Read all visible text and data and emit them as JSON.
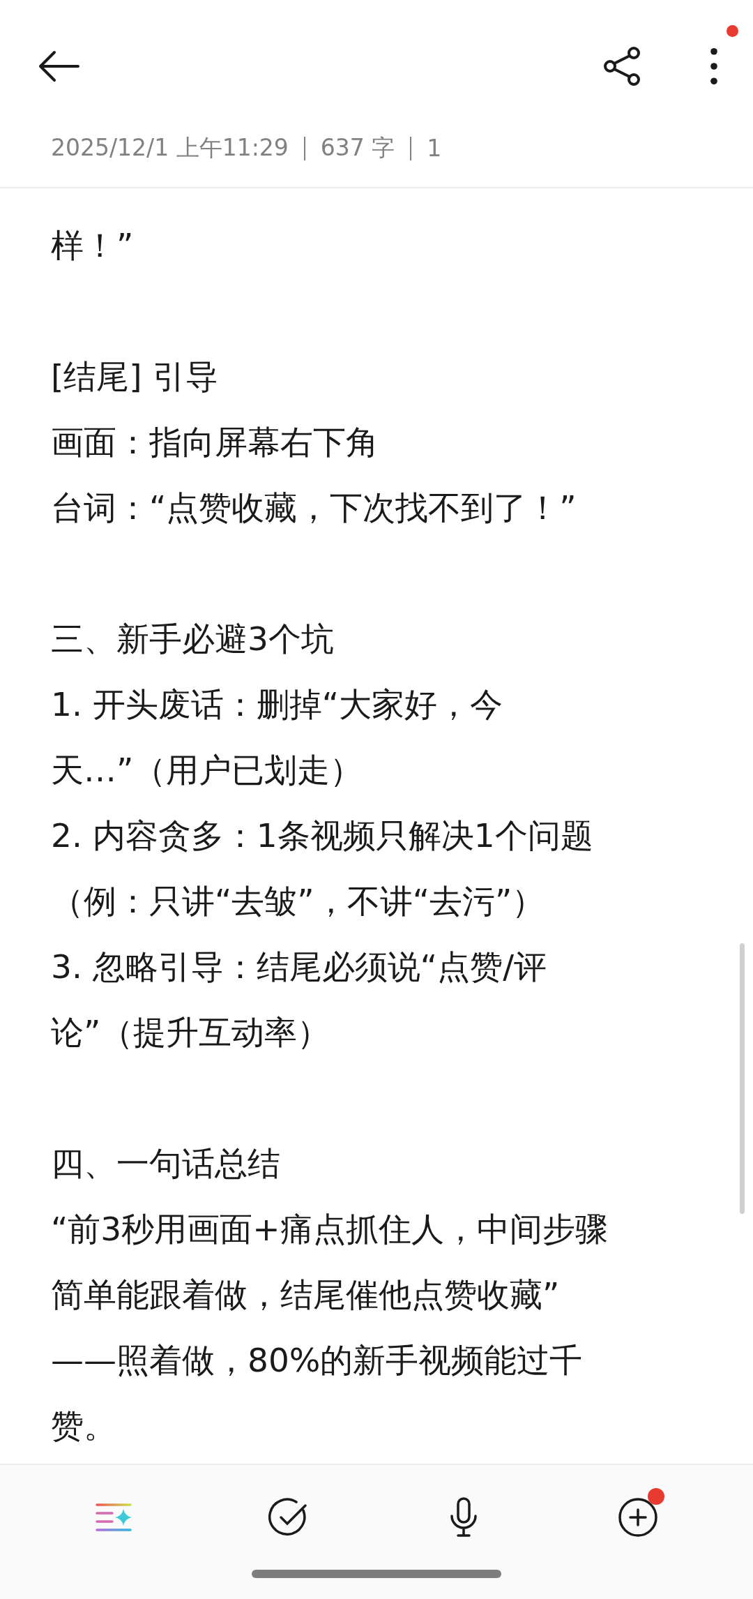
{
  "header": {
    "more_badge": true
  },
  "meta": {
    "date": "2025/12/1 上午11:29",
    "word_count": "637 字",
    "page": "1"
  },
  "paragraphs": [
    [
      "样！”"
    ],
    [
      "[结尾] 引导",
      "画面：指向屏幕右下角",
      "台词：“点赞收藏，下次找不到了！”"
    ],
    [
      "三、新手必避3个坑",
      "1. 开头废话：删掉“大家好，今",
      "天…”（用户已划走）",
      "2. 内容贪多：1条视频只解决1个问题",
      "（例：只讲“去皱”，不讲“去污”）",
      "3. 忽略引导：结尾必须说“点赞/评",
      "论”（提升互动率）"
    ],
    [
      "四、一句话总结",
      "“前3秒用画面+痛点抓住人，中间步骤",
      "简单能跟着做，结尾催他点赞收藏”",
      "——照着做，80%的新手视频能过千",
      "赞。"
    ]
  ],
  "toolbar": [
    {
      "kind": "ai",
      "badge": false
    },
    {
      "kind": "check",
      "badge": false
    },
    {
      "kind": "mic",
      "badge": false
    },
    {
      "kind": "add",
      "badge": true
    }
  ]
}
